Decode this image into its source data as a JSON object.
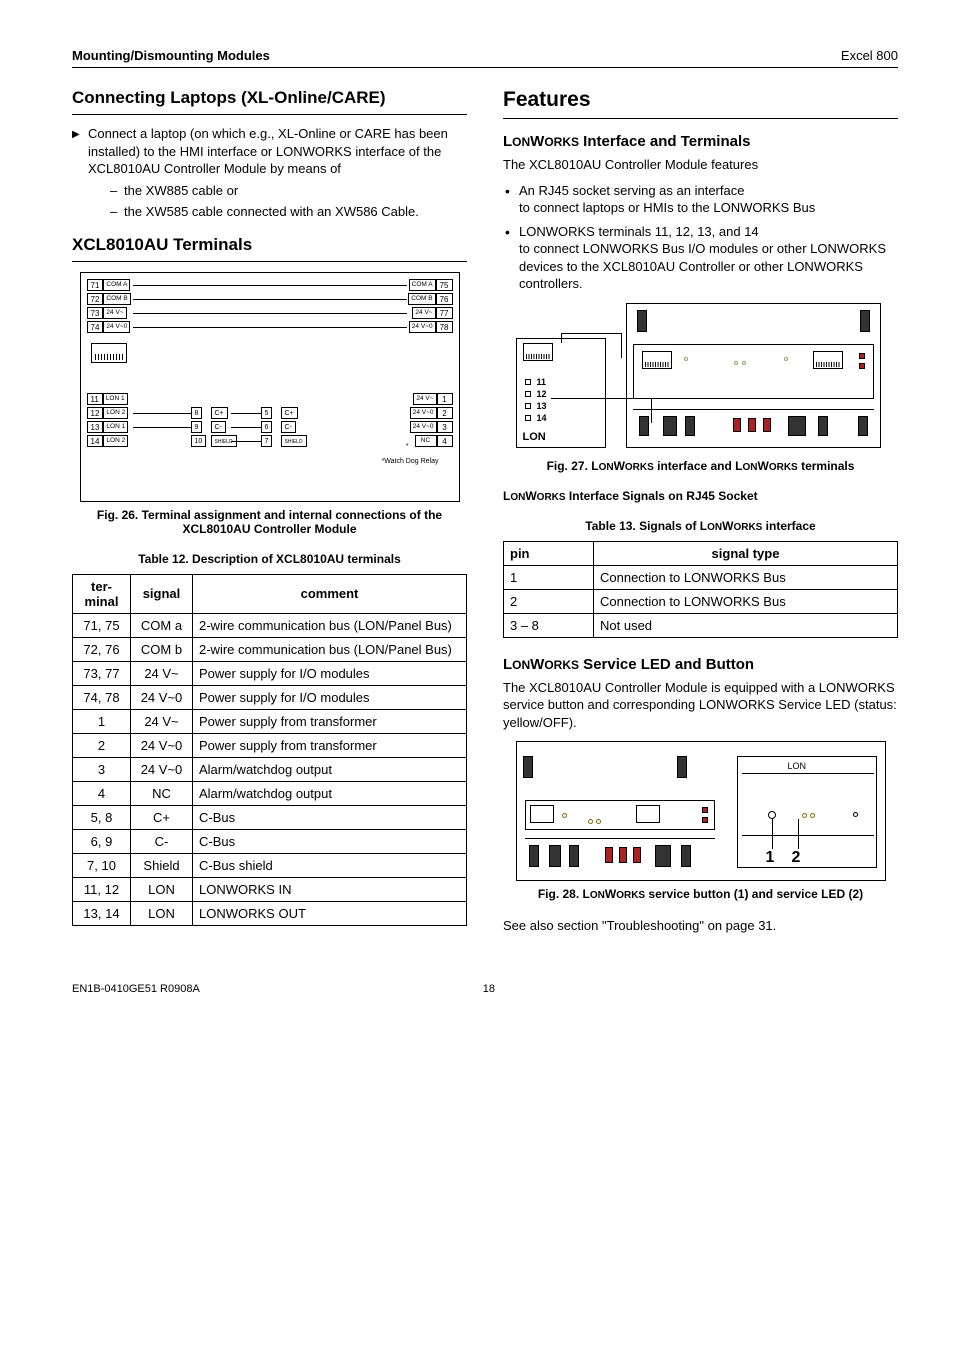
{
  "header": {
    "left": "Mounting/Dismounting Modules",
    "right": "Excel 800"
  },
  "left": {
    "h_connect": "Connecting Laptops (XL-Online/CARE)",
    "connect_intro": "Connect a laptop (on which e.g., XL-Online or CARE has been installed) to the HMI interface or LONWORKS interface of the XCL8010AU Controller Module by means of",
    "connect_opt1": "the XW885 cable or",
    "connect_opt2": "the XW585 cable connected with an XW586 Cable.",
    "h_term": "XCL8010AU Terminals",
    "fig26_caption": "Fig. 26. Terminal assignment and internal connections of the XCL8010AU Controller Module",
    "fig26": {
      "top_left": [
        {
          "n": "71",
          "l": "COM A"
        },
        {
          "n": "72",
          "l": "COM B"
        },
        {
          "n": "73",
          "l": "24 V~"
        },
        {
          "n": "74",
          "l": "24 V~0"
        }
      ],
      "top_right": [
        {
          "n": "75",
          "l": "COM A"
        },
        {
          "n": "76",
          "l": "COM B"
        },
        {
          "n": "77",
          "l": "24 V~"
        },
        {
          "n": "78",
          "l": "24 V~0"
        }
      ],
      "bot_left": [
        {
          "n": "11",
          "l": "LON 1"
        },
        {
          "n": "12",
          "l": "LON 2"
        },
        {
          "n": "13",
          "l": "LON 1"
        },
        {
          "n": "14",
          "l": "LON 2"
        }
      ],
      "bot_right": [
        {
          "n": "1",
          "l": "24 V~"
        },
        {
          "n": "2",
          "l": "24 V~0"
        },
        {
          "n": "3",
          "l": "24 V~0"
        },
        {
          "n": "4",
          "l": "NC"
        }
      ],
      "mid1": [
        {
          "n": "8",
          "l": "C+"
        },
        {
          "n": "9",
          "l": "C-"
        },
        {
          "n": "10",
          "l": "SHIELD"
        }
      ],
      "mid2": [
        {
          "n": "5",
          "l": "C+"
        },
        {
          "n": "6",
          "l": "C-"
        },
        {
          "n": "7",
          "l": "SHIELD"
        }
      ],
      "watchdog": "*Watch Dog Relay",
      "star": "*"
    },
    "tbl12_caption": "Table 12. Description of XCL8010AU terminals",
    "tbl12_headers": [
      "ter-minal",
      "signal",
      "comment"
    ],
    "tbl12_rows": [
      [
        "71, 75",
        "COM a",
        "2-wire communication bus (LON/Panel Bus)"
      ],
      [
        "72, 76",
        "COM b",
        "2-wire communication bus (LON/Panel Bus)"
      ],
      [
        "73, 77",
        "24 V~",
        "Power supply for I/O modules"
      ],
      [
        "74, 78",
        "24 V~0",
        "Power supply for I/O modules"
      ],
      [
        "1",
        "24 V~",
        "Power supply from transformer"
      ],
      [
        "2",
        "24 V~0",
        "Power supply from transformer"
      ],
      [
        "3",
        "24 V~0",
        "Alarm/watchdog output"
      ],
      [
        "4",
        "NC",
        "Alarm/watchdog output"
      ],
      [
        "5, 8",
        "C+",
        "C-Bus"
      ],
      [
        "6, 9",
        "C-",
        "C-Bus"
      ],
      [
        "7, 10",
        "Shield",
        "C-Bus shield"
      ],
      [
        "11, 12",
        "LON",
        "LONWORKS IN"
      ],
      [
        "13, 14",
        "LON",
        "LONWORKS OUT"
      ]
    ]
  },
  "right": {
    "h_features": "Features",
    "h_iface": "LONWORKS Interface and Terminals",
    "iface_intro": "The XCL8010AU Controller Module features",
    "iface_b1a": "An RJ45 socket serving as an interface",
    "iface_b1b": "to connect laptops or HMIs to the LONWORKS Bus",
    "iface_b2a": "LONWORKS terminals 11, 12, 13, and 14",
    "iface_b2b": "to connect LONWORKS Bus I/O modules or other LONWORKS devices to the XCL8010AU Controller or other LONWORKS controllers.",
    "fig27_caption": "Fig. 27. LONWORKS interface and LONWORKS terminals",
    "fig27": {
      "lon": "LON",
      "pins": [
        "11",
        "12",
        "13",
        "14"
      ]
    },
    "sockhdr": "LONWORKS Interface Signals on RJ45 Socket",
    "tbl13_caption": "Table 13. Signals of LONWORKS interface",
    "tbl13_headers": [
      "pin",
      "signal type"
    ],
    "tbl13_rows": [
      [
        "1",
        "Connection to LONWORKS Bus"
      ],
      [
        "2",
        "Connection to LONWORKS Bus"
      ],
      [
        "3 – 8",
        "Not used"
      ]
    ],
    "h_led": "LONWORKS Service LED and Button",
    "led_p1": "The XCL8010AU Controller Module is equipped with a LONWORKS service button and corresponding LONWORKS Service LED (status: yellow/OFF).",
    "fig28_caption": "Fig. 28. LONWORKS service button (1) and service LED (2)",
    "fig28": {
      "lon": "LON",
      "n1": "1",
      "n2": "2"
    },
    "seealso": "See also section \"Troubleshooting\" on page 31."
  },
  "footer": {
    "left": "EN1B-0410GE51 R0908A",
    "center": "18"
  }
}
